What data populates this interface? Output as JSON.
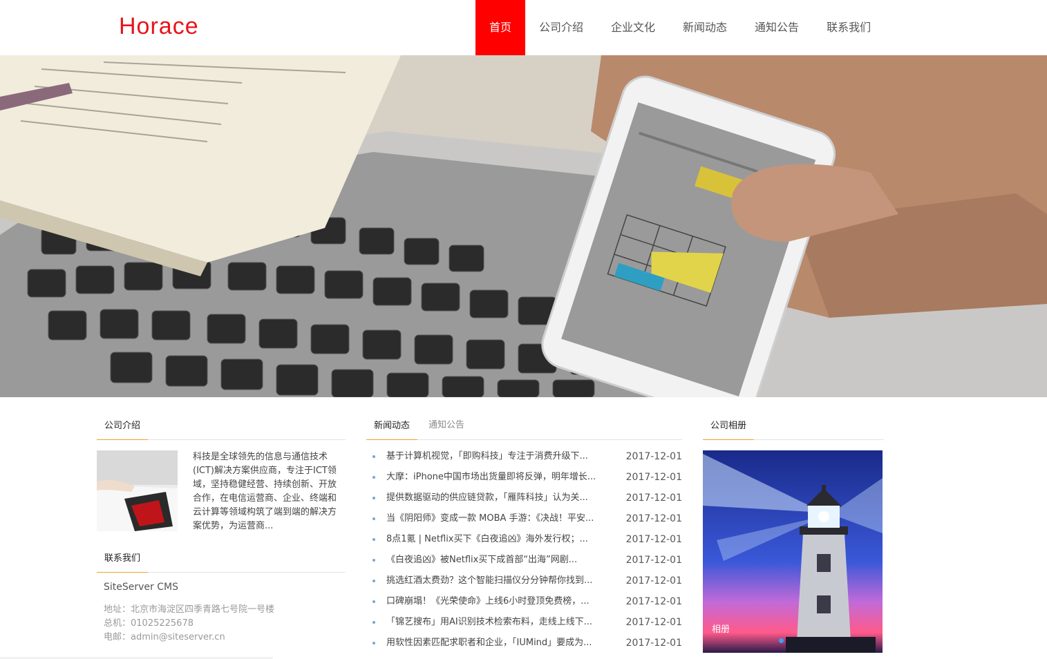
{
  "header": {
    "logo": "Horace",
    "nav": [
      {
        "label": "首页",
        "active": true
      },
      {
        "label": "公司介绍"
      },
      {
        "label": "企业文化"
      },
      {
        "label": "新闻动态"
      },
      {
        "label": "通知公告"
      },
      {
        "label": "联系我们"
      }
    ]
  },
  "banner": {
    "dots": 3,
    "active_dot": 0
  },
  "intro": {
    "title": "公司介绍",
    "text": "科技是全球领先的信息与通信技术(ICT)解决方案供应商，专注于ICT领域，坚持稳健经营、持续创新、开放合作，在电信运营商、企业、终端和云计算等领域构筑了端到端的解决方案优势，为运营商..."
  },
  "contact": {
    "title": "联系我们",
    "name": "SiteServer CMS",
    "address": "地址：北京市海淀区四季青路七号院一号楼",
    "phone": "总机：01025225678",
    "email": "电邮：admin@siteserver.cn"
  },
  "news": {
    "tabs": [
      "新闻动态",
      "通知公告"
    ],
    "items": [
      {
        "title": "基于计算机视觉，「即购科技」专注于消费升级下...",
        "date": "2017-12-01"
      },
      {
        "title": "大摩：iPhone中国市场出货量即将反弹，明年增长...",
        "date": "2017-12-01"
      },
      {
        "title": "提供数据驱动的供应链贷款，「雁阵科技」认为关...",
        "date": "2017-12-01"
      },
      {
        "title": "当《阴阳师》变成一款 MOBA 手游：《决战！平安...",
        "date": "2017-12-01"
      },
      {
        "title": "8点1氪 | Netflix买下《白夜追凶》海外发行权；...",
        "date": "2017-12-01"
      },
      {
        "title": "《白夜追凶》被Netflix买下成首部“出海”网剧...",
        "date": "2017-12-01"
      },
      {
        "title": "挑选红酒太费劲？这个智能扫描仪分分钟帮你找到...",
        "date": "2017-12-01"
      },
      {
        "title": "口碑崩塌！《光荣使命》上线6小时登顶免费榜，...",
        "date": "2017-12-01"
      },
      {
        "title": "「锦艺搜布」用AI识别技术检索布料，走线上线下...",
        "date": "2017-12-01"
      },
      {
        "title": "用软性因素匹配求职者和企业，「IUMind」要成为...",
        "date": "2017-12-01"
      }
    ]
  },
  "album": {
    "title": "公司相册",
    "caption": "相册"
  }
}
